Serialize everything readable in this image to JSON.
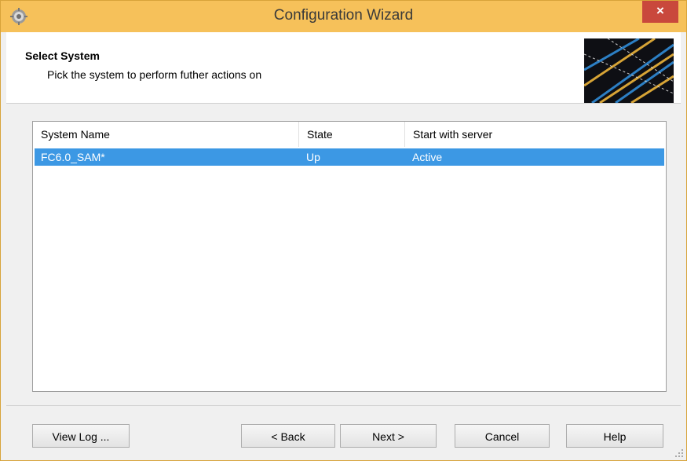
{
  "window": {
    "title": "Configuration Wizard",
    "close_label": "×"
  },
  "header": {
    "title": "Select System",
    "subtitle": "Pick the system to perform futher actions on"
  },
  "table": {
    "columns": [
      "System Name",
      "State",
      "Start with server"
    ],
    "rows": [
      {
        "system_name": "FC6.0_SAM*",
        "state": "Up",
        "start_with_server": "Active",
        "selected": true
      }
    ]
  },
  "buttons": {
    "view_log": "View Log ...",
    "back": "< Back",
    "next": "Next >",
    "cancel": "Cancel",
    "help": "Help"
  },
  "colors": {
    "titlebar": "#f6c15a",
    "close": "#c9483c",
    "selection": "#3c98e4"
  },
  "icons": [
    "settings-icon",
    "close-icon",
    "header-graphic",
    "resize-grip-icon"
  ]
}
